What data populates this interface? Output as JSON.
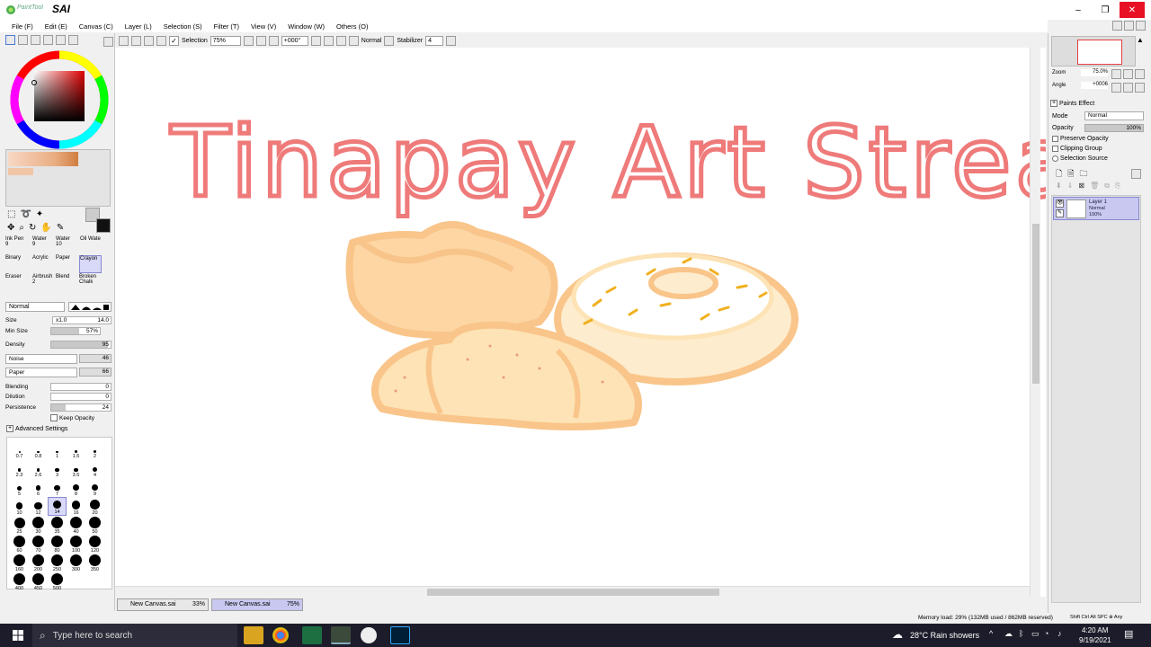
{
  "app": {
    "logo_text": "SAI",
    "logo_sub": "PaintTool",
    "win_minimize": "–",
    "win_restore": "❐",
    "win_close": "✕"
  },
  "menu": [
    "File (F)",
    "Edit (E)",
    "Canvas (C)",
    "Layer (L)",
    "Selection (S)",
    "Filter (T)",
    "View (V)",
    "Window (W)",
    "Others (O)"
  ],
  "toolbar": {
    "selection_label": "Selection",
    "zoom": "75%",
    "angle": "+000°",
    "mode": "Normal",
    "stabilizer_label": "Stabilizer",
    "stabilizer_value": "4"
  },
  "tools": [
    {
      "name": "Ink Pen",
      "sub": "9"
    },
    {
      "name": "Water",
      "sub": "9"
    },
    {
      "name": "Water",
      "sub": "10"
    },
    {
      "name": "Oil Wate",
      "sub": ""
    },
    {
      "name": "Binary",
      "sub": ""
    },
    {
      "name": "Acrylic",
      "sub": ""
    },
    {
      "name": "Paper",
      "sub": ""
    },
    {
      "name": "Crayon",
      "sub": ""
    },
    {
      "name": "Eraser",
      "sub": ""
    },
    {
      "name": "Airbrush",
      "sub": "2"
    },
    {
      "name": "Blend",
      "sub": ""
    },
    {
      "name": "Broken Chalk",
      "sub": ""
    }
  ],
  "brush": {
    "blend_mode": "Normal",
    "size_label": "Size",
    "size_mult": "x1.0",
    "size_value": "14.0",
    "minsize_label": "Min Size",
    "minsize_value": "57%",
    "minsize_fill": 0.57,
    "density_label": "Density",
    "density_value": "95",
    "density_fill": 0.95,
    "texture1": "Noise",
    "texture1_value": "46",
    "texture2": "Paper",
    "texture2_value": "66",
    "blending_label": "Blending",
    "blending_value": "0",
    "dilution_label": "Dilution",
    "dilution_value": "0",
    "persistence_label": "Persistence",
    "persistence_value": "24",
    "persistence_fill": 0.24,
    "keep_opacity": "Keep Opacity",
    "advanced": "Advanced Settings"
  },
  "brush_sizes": [
    "0.7",
    "0.8",
    "1",
    "1.5",
    "2",
    "2.3",
    "2.6",
    "3",
    "3.5",
    "4",
    "5",
    "6",
    "7",
    "8",
    "9",
    "10",
    "12",
    "14",
    "16",
    "20",
    "25",
    "30",
    "35",
    "40",
    "50",
    "60",
    "70",
    "80",
    "100",
    "120",
    "160",
    "200",
    "250",
    "300",
    "350",
    "400",
    "450",
    "500"
  ],
  "canvas": {
    "title_text": "Tinapay Art Stream"
  },
  "canvas_tabs": [
    {
      "name": "New Canvas.sai",
      "zoom": "33%"
    },
    {
      "name": "New Canvas.sai",
      "zoom": "75%"
    }
  ],
  "navigator": {
    "zoom_label": "Zoom",
    "zoom_value": "75.0%",
    "angle_label": "Angle",
    "angle_value": "+0006"
  },
  "layer_panel": {
    "paints_effect": "Paints Effect",
    "mode_label": "Mode",
    "mode_value": "Normal",
    "opacity_label": "Opacity",
    "opacity_value": "100%",
    "preserve_opacity": "Preserve Opacity",
    "clipping_group": "Clipping Group",
    "selection_source": "Selection Source",
    "layer_name": "Layer 1",
    "layer_mode": "Normal",
    "layer_opacity": "100%"
  },
  "status": {
    "memory": "Memory load: 29% (132MB used / 862MB reserved)",
    "keys": "Shift Ctrl Alt SPC ⊕ Any"
  },
  "taskbar": {
    "search_placeholder": "Type here to search",
    "weather": "28°C  Rain showers",
    "time": "4:20 AM",
    "date": "9/19/2021"
  },
  "colors": {
    "text_pink": "#ef7a7a",
    "bread_fill": "#fde3b5",
    "bread_outline": "#f9c58a",
    "sprinkle": "#f0b020",
    "accent": "#c8c8f0",
    "close_red": "#e81123"
  }
}
